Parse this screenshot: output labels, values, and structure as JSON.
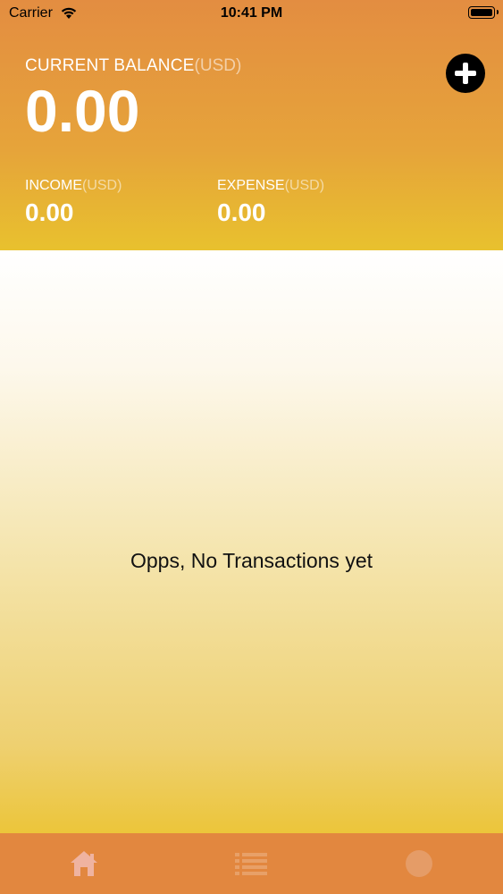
{
  "status_bar": {
    "carrier": "Carrier",
    "time": "10:41 PM"
  },
  "balance": {
    "label": "CURRENT BALANCE",
    "currency": "(USD)",
    "value": "0.00"
  },
  "income": {
    "label": "INCOME",
    "currency": "(USD)",
    "value": "0.00"
  },
  "expense": {
    "label": "EXPENSE",
    "currency": "(USD)",
    "value": "0.00"
  },
  "empty_state": {
    "message": "Opps, No Transactions yet"
  },
  "icons": {
    "add": "plus-circle-icon",
    "home": "home-icon",
    "list": "list-icon",
    "settings": "circle-icon"
  },
  "colors": {
    "header_top": "#e38d41",
    "header_bottom": "#e8c12e",
    "tab_bar": "#e2873f"
  }
}
